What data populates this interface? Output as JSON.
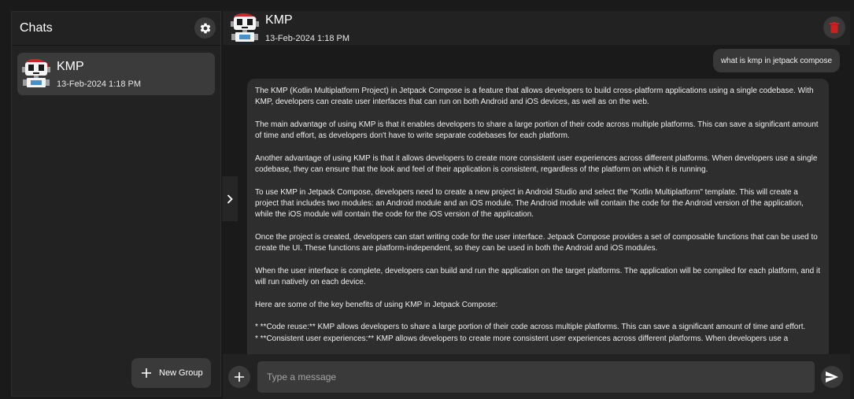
{
  "sidebar": {
    "title": "Chats",
    "settings_icon": "gear-icon",
    "chats": [
      {
        "name": "KMP",
        "date": "13-Feb-2024 1:18 PM",
        "avatar_icon": "robot-avatar-icon"
      }
    ],
    "new_group_label": "New Group",
    "new_group_icon": "plus-icon"
  },
  "header": {
    "name": "KMP",
    "date": "13-Feb-2024 1:18 PM",
    "avatar_icon": "robot-avatar-icon",
    "delete_icon": "trash-icon"
  },
  "collapse_icon": "chevron-right-icon",
  "messages": {
    "user": "what is kmp in jetpack compose",
    "bot_paragraphs": [
      "The KMP (Kotlin Multiplatform Project) in Jetpack Compose is a feature that allows developers to build cross-platform applications using a single codebase. With KMP, developers can create user interfaces that can run on both Android and iOS devices, as well as on the web.",
      "The main advantage of using KMP is that it enables developers to share a large portion of their code across multiple platforms. This can save a significant amount of time and effort, as developers don't have to write separate codebases for each platform.",
      "Another advantage of using KMP is that it allows developers to create more consistent user experiences across different platforms. When developers use a single codebase, they can ensure that the look and feel of their application is consistent, regardless of the platform on which it is running.",
      "To use KMP in Jetpack Compose, developers need to create a new project in Android Studio and select the \"Kotlin Multiplatform\" template. This will create a project that includes two modules: an Android module and an iOS module. The Android module will contain the code for the Android version of the application, while the iOS module will contain the code for the iOS version of the application.",
      "Once the project is created, developers can start writing code for the user interface. Jetpack Compose provides a set of composable functions that can be used to create the UI. These functions are platform-independent, so they can be used in both the Android and iOS modules.",
      "When the user interface is complete, developers can build and run the application on the target platforms. The application will be compiled for each platform, and it will run natively on each device.",
      "Here are some of the key benefits of using KMP in Jetpack Compose:",
      "* **Code reuse:** KMP allows developers to share a large portion of their code across multiple platforms. This can save a significant amount of time and effort.",
      "* **Consistent user experiences:** KMP allows developers to create more consistent user experiences across different platforms. When developers use a"
    ]
  },
  "composer": {
    "placeholder": "Type a message",
    "attach_icon": "plus-icon",
    "send_icon": "send-icon"
  },
  "colors": {
    "background": "#1a1a1a",
    "panel": "#222222",
    "selected_chat": "#3b3b3b",
    "bubble": "#2e2e2e",
    "input": "#3a3a3a",
    "delete": "#cc1f1f"
  }
}
